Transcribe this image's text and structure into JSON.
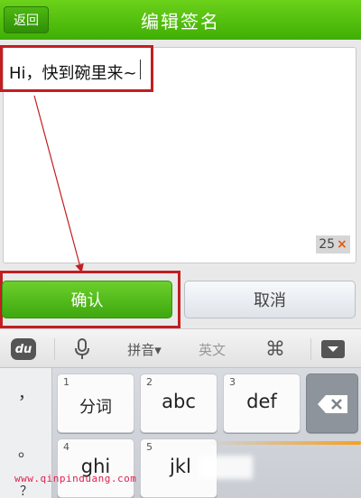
{
  "header": {
    "back_label": "返回",
    "title": "编辑签名"
  },
  "editor": {
    "value": "Hi，快到碗里来~",
    "remaining_count": "25",
    "clear_glyph": "×"
  },
  "actions": {
    "confirm_label": "确认",
    "cancel_label": "取消"
  },
  "keyboard_toolbar": {
    "logo_label": "du",
    "pinyin_label": "拼音▾",
    "english_label": "英文",
    "command_glyph": "⌘",
    "icons": [
      "du-logo-icon",
      "microphone-icon",
      "command-icon",
      "collapse-keyboard-icon"
    ]
  },
  "keyboard": {
    "side_keys": [
      "，",
      "。",
      "？"
    ],
    "keys": [
      {
        "num": "1",
        "label": "分词"
      },
      {
        "num": "2",
        "label": "abc"
      },
      {
        "num": "3",
        "label": "def"
      },
      {
        "num": "4",
        "label": "ghi"
      },
      {
        "num": "5",
        "label": "jkl"
      }
    ]
  },
  "watermark": "www.qinpinduang.com",
  "colors": {
    "header_green": "#3fae05",
    "highlight_red": "#c21e22",
    "watermark_red": "#e0204f"
  }
}
